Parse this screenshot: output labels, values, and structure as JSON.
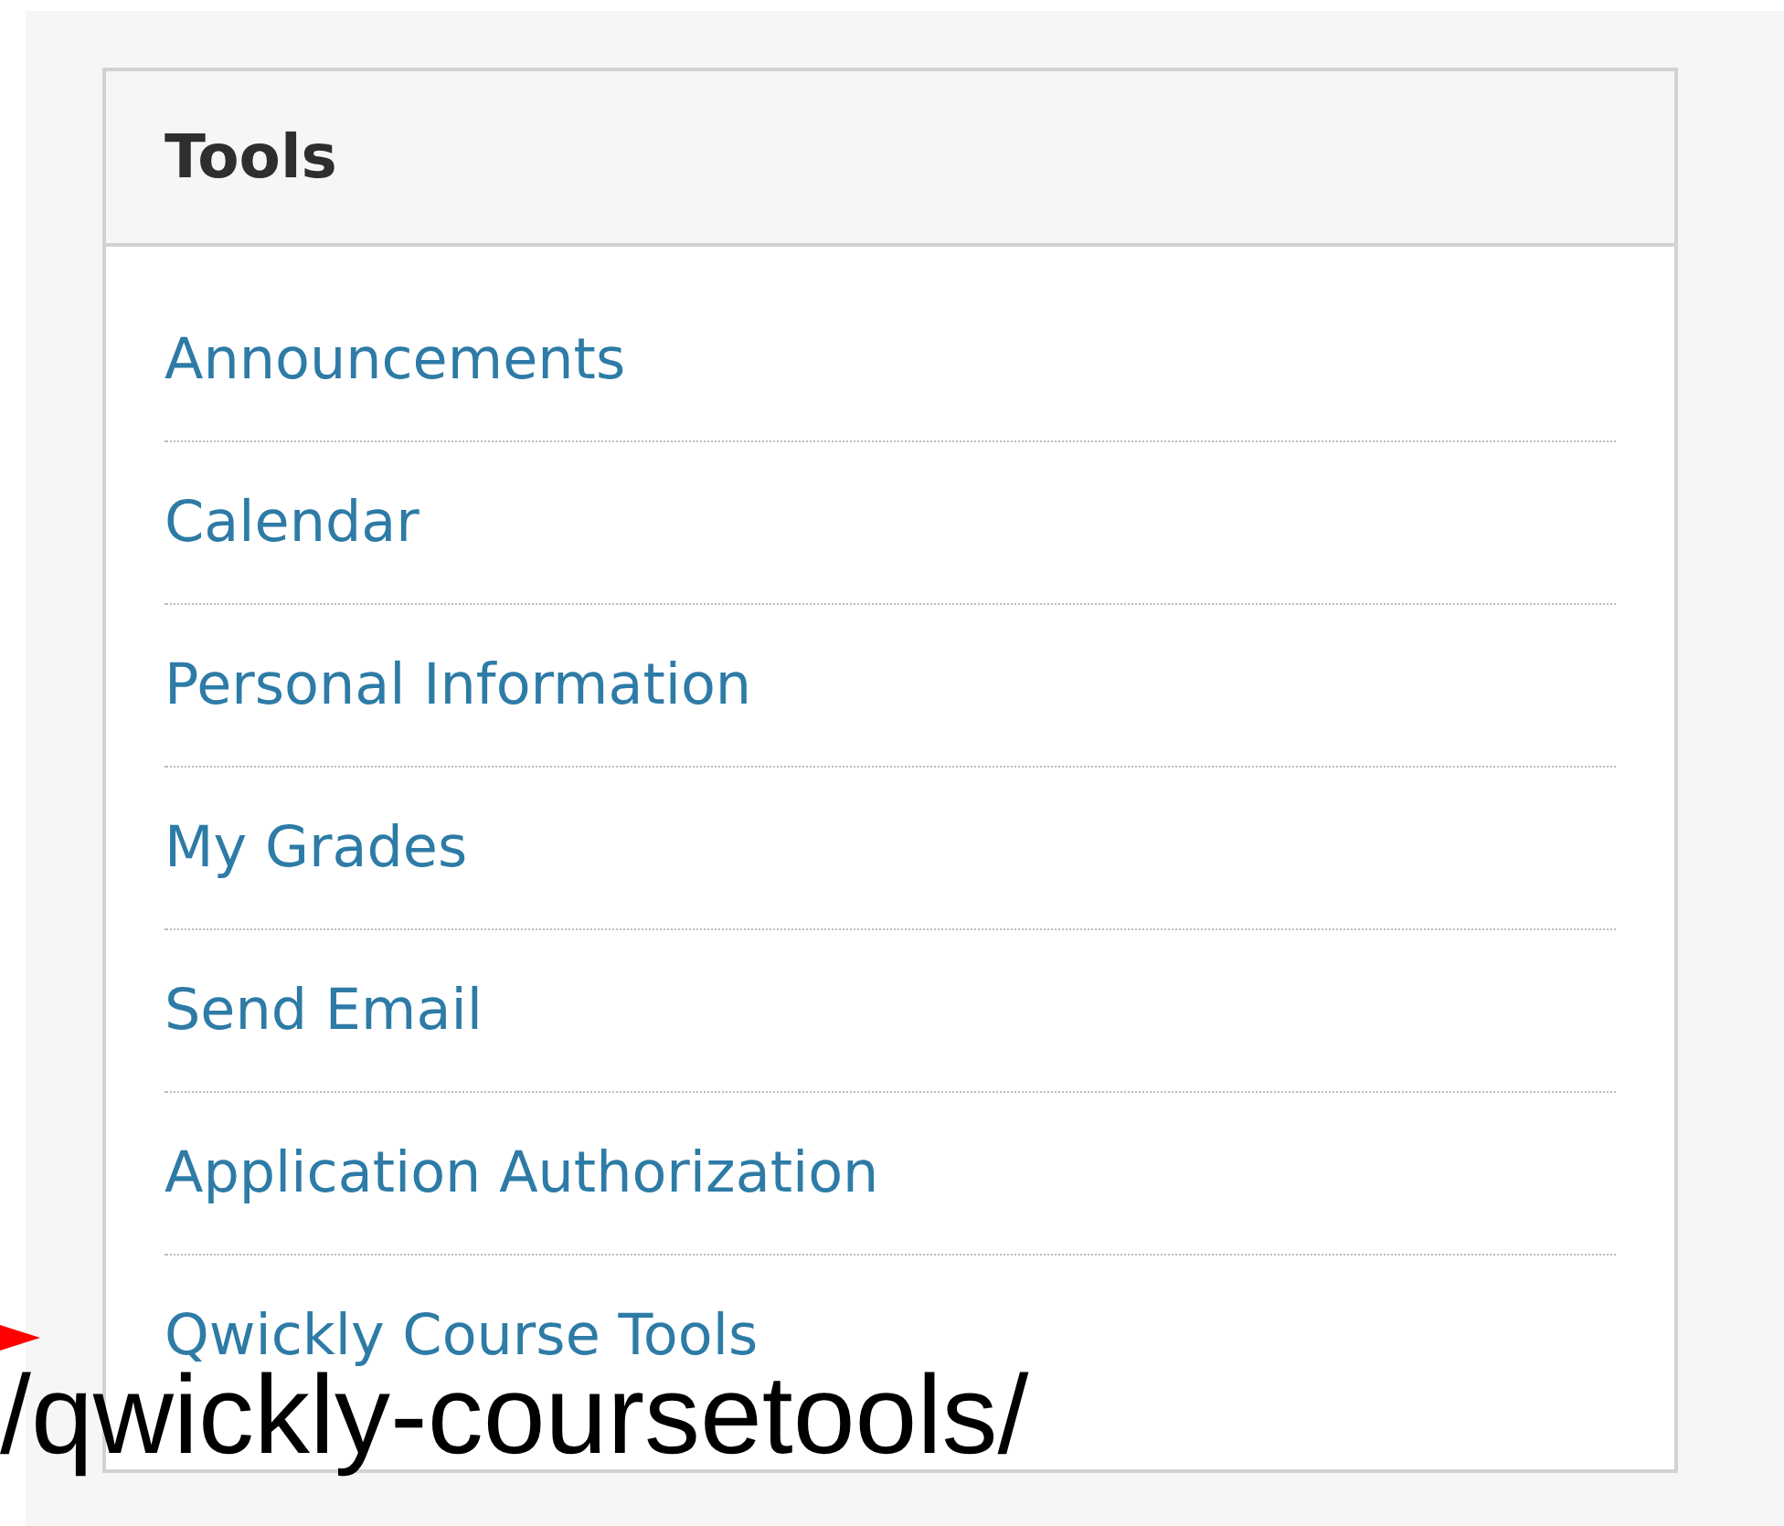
{
  "panel": {
    "title": "Tools",
    "items": [
      {
        "label": "Announcements"
      },
      {
        "label": "Calendar"
      },
      {
        "label": "Personal Information"
      },
      {
        "label": "My Grades"
      },
      {
        "label": "Send Email"
      },
      {
        "label": "Application Authorization"
      },
      {
        "label": "Qwickly Course Tools"
      }
    ]
  },
  "annotation": {
    "text": "/qwickly-coursetools/"
  }
}
